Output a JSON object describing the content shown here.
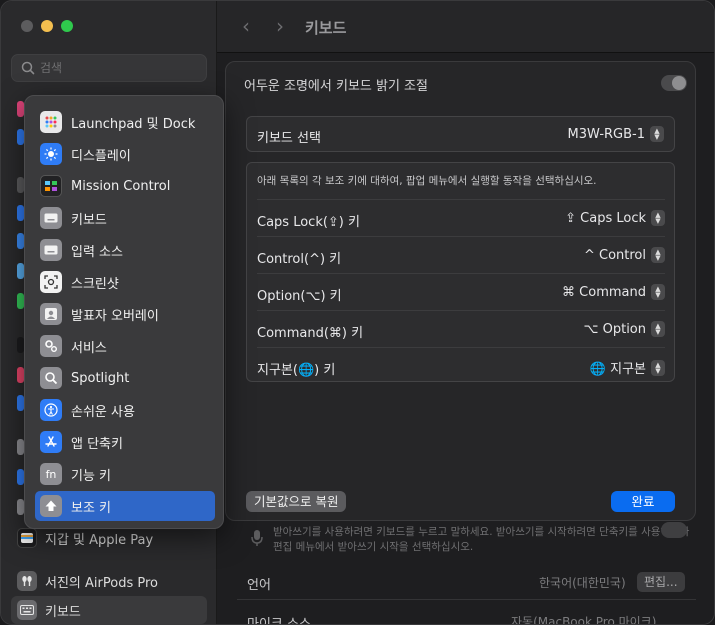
{
  "window": {
    "title": "키보드"
  },
  "search": {
    "placeholder": "검색"
  },
  "sidebar_bottom": [
    {
      "label": "지갑 및 Apple Pay",
      "icon": "wallet-icon"
    },
    {
      "label": "서진의 AirPods Pro",
      "icon": "airpods-icon"
    },
    {
      "label": "키보드",
      "icon": "keyboard-icon"
    }
  ],
  "menu": {
    "items": [
      {
        "label": "Launchpad 및 Dock",
        "icon": "launchpad-icon",
        "color": "#e9e9ea"
      },
      {
        "label": "디스플레이",
        "icon": "display-icon",
        "color": "#2f7cf6"
      },
      {
        "label": "Mission Control",
        "icon": "mission-control-icon",
        "color": "#222224"
      },
      {
        "label": "키보드",
        "icon": "keyboard-icon",
        "color": "#8e8e93"
      },
      {
        "label": "입력 소스",
        "icon": "input-sources-icon",
        "color": "#8e8e93"
      },
      {
        "label": "스크린샷",
        "icon": "screenshot-icon",
        "color": "#f2f2f2"
      },
      {
        "label": "발표자 오버레이",
        "icon": "presenter-overlay-icon",
        "color": "#8e8e93"
      },
      {
        "label": "서비스",
        "icon": "services-icon",
        "color": "#8e8e93"
      },
      {
        "label": "Spotlight",
        "icon": "spotlight-icon",
        "color": "#8e8e93"
      },
      {
        "label": "손쉬운 사용",
        "icon": "accessibility-icon",
        "color": "#2f7cf6"
      },
      {
        "label": "앱 단축키",
        "icon": "app-shortcuts-icon",
        "color": "#2f7cf6"
      },
      {
        "label": "기능 키",
        "icon": "fn-key-icon",
        "color": "#8e8e93"
      },
      {
        "label": "보조 키",
        "icon": "modifier-keys-icon",
        "color": "#8e8e93"
      }
    ],
    "selected_index": 12
  },
  "sheet": {
    "backlight_label": "어두운 조명에서 키보드 밝기 조절",
    "keyboard_select_label": "키보드 선택",
    "keyboard_select_value": "M3W-RGB-1",
    "modifier_description": "아래 목록의 각 보조 키에 대하여, 팝업 메뉴에서 실행할 동작을 선택하십시오.",
    "modifier_rows": [
      {
        "label": "Caps Lock(⇪) 키",
        "value": "⇪ Caps Lock"
      },
      {
        "label": "Control(^) 키",
        "value": "^ Control"
      },
      {
        "label": "Option(⌥) 키",
        "value": "⌘ Command"
      },
      {
        "label": "Command(⌘) 키",
        "value": "⌥ Option"
      },
      {
        "label": "지구본(🌐) 키",
        "value": "🌐 지구본"
      }
    ],
    "reset_button": "기본값으로 복원",
    "done_button": "완료"
  },
  "background": {
    "line1": "받아쓰기를 사용하려면 키보드를 누르고 말하세요. 받아쓰기를 시작하려면 단축키를 사용하거나",
    "line2": "편집 메뉴에서 받아쓰기 시작을 선택하십시오.",
    "language_label": "언어",
    "language_value": "한국어(대한민국)",
    "edit_button": "편집...",
    "mic_label": "마이크 소스",
    "mic_value": "자동(MacBook Pro 마이크)"
  },
  "colors": {
    "accent": "#0a6cf0",
    "selection": "#2f67c8"
  }
}
